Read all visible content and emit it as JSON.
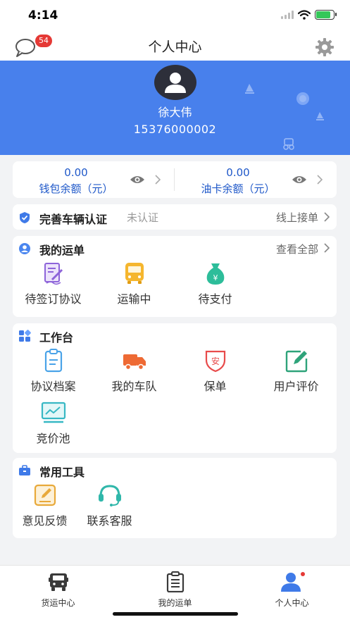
{
  "status_bar": {
    "time": "4:14"
  },
  "nav": {
    "title": "个人中心",
    "message_badge": "54"
  },
  "profile": {
    "name": "徐大伟",
    "phone": "15376000002"
  },
  "balances": [
    {
      "value": "0.00",
      "label": "钱包余额（元）"
    },
    {
      "value": "0.00",
      "label": "油卡余额（元）"
    }
  ],
  "verify": {
    "title": "完善车辆认证",
    "status": "未认证",
    "right_link": "线上接单"
  },
  "orders": {
    "title": "我的运单",
    "view_all": "查看全部",
    "items": [
      {
        "label": "待签订协议",
        "icon": "sign-contract-icon"
      },
      {
        "label": "运输中",
        "icon": "bus-icon"
      },
      {
        "label": "待支付",
        "icon": "money-bag-icon"
      }
    ]
  },
  "workbench": {
    "title": "工作台",
    "items": [
      {
        "label": "协议档案",
        "icon": "clipboard-icon"
      },
      {
        "label": "我的车队",
        "icon": "truck-icon"
      },
      {
        "label": "保单",
        "icon": "insurance-icon"
      },
      {
        "label": "用户评价",
        "icon": "edit-icon"
      },
      {
        "label": "竞价池",
        "icon": "chart-icon"
      }
    ]
  },
  "tools": {
    "title": "常用工具",
    "items": [
      {
        "label": "意见反馈",
        "icon": "feedback-icon"
      },
      {
        "label": "联系客服",
        "icon": "headset-icon"
      }
    ]
  },
  "tabs": [
    {
      "label": "货运中心",
      "icon": "truck-front-icon"
    },
    {
      "label": "我的运单",
      "icon": "clipboard-list-icon"
    },
    {
      "label": "个人中心",
      "icon": "person-icon",
      "active": true
    }
  ],
  "colors": {
    "brand_blue": "#4880ec",
    "balance_text": "#1f58c9",
    "badge_red": "#e53935",
    "active_tab": "#3f7ae8"
  }
}
